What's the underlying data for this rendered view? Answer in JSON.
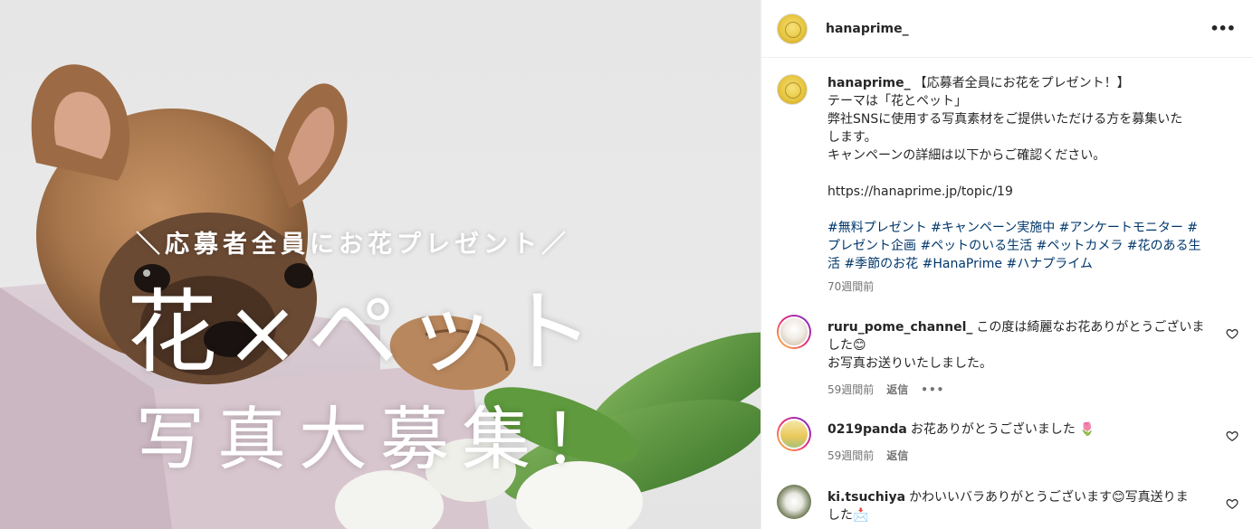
{
  "post": {
    "username": "hanaprime_",
    "more_icon": "more-horizontal-icon",
    "image": {
      "subtitle": "＼応募者全員にお花プレゼント／",
      "title": "花×ペット",
      "subtitle2": "写真大募集！"
    },
    "caption": {
      "username": "hanaprime_",
      "lines": [
        "【応募者全員にお花をプレゼント！】",
        "テーマは「花とペット」",
        "弊社SNSに使用する写真素材をご提供いただける方を募集いた",
        "します。",
        "キャンペーンの詳細は以下からご確認ください。",
        "",
        "https://hanaprime.jp/topic/19",
        ""
      ],
      "hashtag_lines": [
        "#無料プレゼント #キャンペーン実施中 #アンケートモニター #",
        "プレゼント企画 #ペットのいる生活 #ペットカメラ #花のある生",
        "活 #季節のお花 #HanaPrime #ハナプライム"
      ],
      "time": "70週間前"
    },
    "comments": [
      {
        "username": "ruru_pome_channel_",
        "lines": [
          "この度は綺麗なお花ありがとうございま",
          "した😊",
          "お写真お送りいたしました。"
        ],
        "time": "59週間前",
        "reply": "返信",
        "more": "•••"
      },
      {
        "username": "0219panda",
        "lines": [
          "お花ありがとうございました 🌷"
        ],
        "time": "59週間前",
        "reply": "返信"
      },
      {
        "username": "ki.tsuchiya",
        "lines": [
          "かわいいバラありがとうございます😊写真送りま",
          "した📩"
        ]
      }
    ]
  },
  "colors": {
    "text": "#262626",
    "muted": "#737373",
    "hashtag": "#00376b",
    "border": "#efefef"
  }
}
